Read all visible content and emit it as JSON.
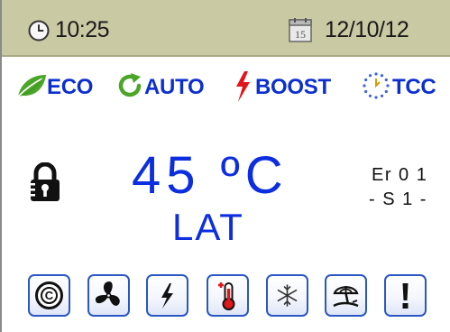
{
  "status_bar": {
    "time": "10:25",
    "date_icon_day": "15",
    "date": "12/10/12",
    "icons": [
      "clock-icon",
      "calendar-icon"
    ]
  },
  "modes": [
    {
      "label": "ECO",
      "icon": "leaf-icon",
      "color": "#4aa528"
    },
    {
      "label": "AUTO",
      "icon": "refresh-icon",
      "color": "#4aa528"
    },
    {
      "label": "BOOST",
      "icon": "lightning-icon",
      "color": "#e0161a"
    },
    {
      "label": "TCC",
      "icon": "dotted-timer-icon",
      "color": "#3d63d6"
    }
  ],
  "main": {
    "temperature": "45 ºC",
    "mode": "LAT",
    "error_code": "Er 0 1",
    "sensor": "- S 1 -",
    "lock_icon": "lock-icon"
  },
  "buttons": [
    {
      "icon": "c-icon"
    },
    {
      "icon": "fan-icon"
    },
    {
      "icon": "electric-icon"
    },
    {
      "icon": "thermometer-plus-icon"
    },
    {
      "icon": "snowflake-icon"
    },
    {
      "icon": "holiday-icon"
    },
    {
      "icon": "alarm-icon"
    }
  ],
  "colors": {
    "status_bar_bg": "#c9c9a4",
    "mode_text": "#0c2fcf",
    "display_blue": "#0c2ee0",
    "button_border": "#2a57c4"
  }
}
